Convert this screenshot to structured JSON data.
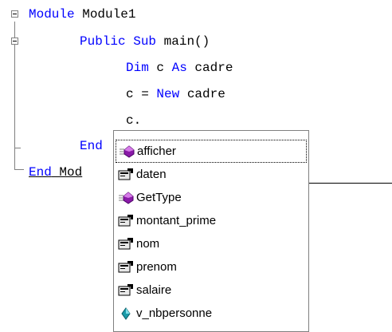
{
  "code": {
    "line1": {
      "kw": "Module",
      "rest": " Module1"
    },
    "line2": {
      "kw1": "Public",
      "kw2": "Sub",
      "rest": " main()"
    },
    "line3": {
      "kw1": "Dim",
      "mid": " c ",
      "kw2": "As",
      "rest": " cadre"
    },
    "line4": {
      "pre": "c = ",
      "kw": "New",
      "rest": " cadre"
    },
    "line5": {
      "text": "c."
    },
    "line6": {
      "kw": "End"
    },
    "line7": {
      "kw": "End",
      "rest": " Mod"
    }
  },
  "popup": {
    "items": [
      {
        "label": "afficher",
        "icon": "method-icon",
        "selected": true
      },
      {
        "label": "daten",
        "icon": "property-icon"
      },
      {
        "label": "GetType",
        "icon": "method-icon"
      },
      {
        "label": "montant_prime",
        "icon": "property-icon"
      },
      {
        "label": "nom",
        "icon": "property-icon"
      },
      {
        "label": "prenom",
        "icon": "property-icon"
      },
      {
        "label": "salaire",
        "icon": "property-icon"
      },
      {
        "label": "v_nbpersonne",
        "icon": "field-icon"
      }
    ]
  },
  "colors": {
    "keyword": "#0000ff",
    "text": "#000000",
    "gutter": "#808080"
  }
}
